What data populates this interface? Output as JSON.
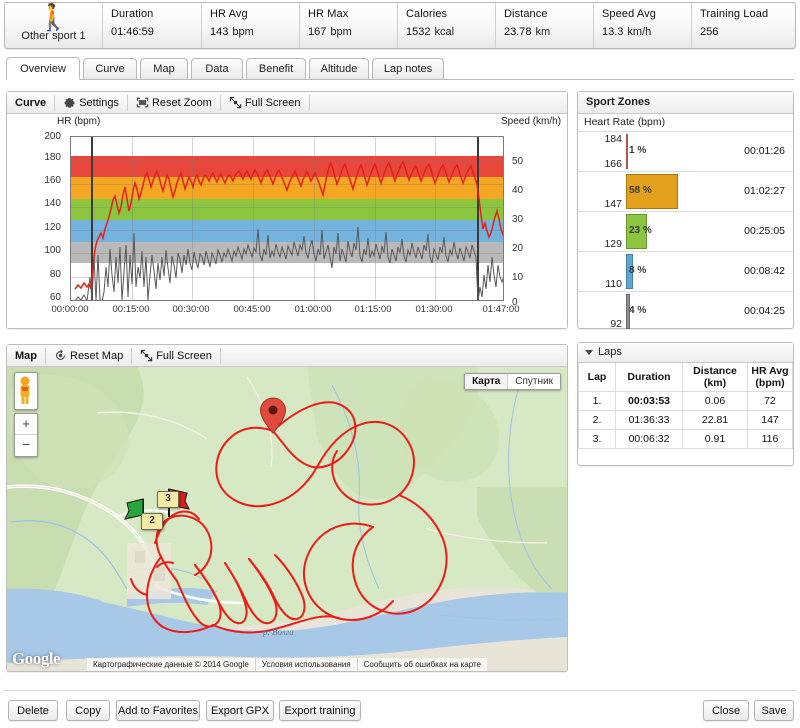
{
  "summary": {
    "sport": {
      "icon": "runner-icon",
      "name": "Other sport 1"
    },
    "cells": [
      {
        "label": "Duration",
        "value": "01:46:59",
        "unit": ""
      },
      {
        "label": "HR Avg",
        "value": "143",
        "unit": "bpm"
      },
      {
        "label": "HR Max",
        "value": "167",
        "unit": "bpm"
      },
      {
        "label": "Calories",
        "value": "1532",
        "unit": "kcal"
      },
      {
        "label": "Distance",
        "value": "23.78",
        "unit": "km"
      },
      {
        "label": "Speed Avg",
        "value": "13.3",
        "unit": "km/h"
      },
      {
        "label": "Training Load",
        "value": "256",
        "unit": ""
      }
    ]
  },
  "tabs": [
    {
      "label": "Overview",
      "active": true
    },
    {
      "label": "Curve",
      "active": false
    },
    {
      "label": "Map",
      "active": false
    },
    {
      "label": "Data",
      "active": false
    },
    {
      "label": "Benefit",
      "active": false
    },
    {
      "label": "Altitude",
      "active": false
    },
    {
      "label": "Lap notes",
      "active": false
    }
  ],
  "curve_panel": {
    "title": "Curve",
    "buttons": [
      {
        "label": "Settings",
        "icon": "gear-icon"
      },
      {
        "label": "Reset Zoom",
        "icon": "reset-zoom-icon"
      },
      {
        "label": "Full Screen",
        "icon": "full-screen-icon"
      }
    ]
  },
  "chart_data": {
    "type": "line",
    "title": "",
    "ylabel": "HR (bpm)",
    "y2label": "Speed (km/h)",
    "xlabel": "",
    "ylim": [
      60,
      200
    ],
    "y2lim": [
      0,
      56
    ],
    "yticks": [
      "200",
      "180",
      "160",
      "140",
      "120",
      "100",
      "80",
      "60"
    ],
    "y2ticks": [
      "50",
      "40",
      "30",
      "20",
      "10",
      "0"
    ],
    "xticks": [
      "00:00:00",
      "00:15:00",
      "00:30:00",
      "00:45:00",
      "01:00:00",
      "01:15:00",
      "01:30:00",
      "01:47:00"
    ],
    "grid": true,
    "legend": "none",
    "zone_bands": [
      {
        "name": "zone5",
        "from": 184,
        "to": 200,
        "color": "#ffffff"
      },
      {
        "name": "zone5",
        "from": 166,
        "to": 184,
        "color": "#e8483c"
      },
      {
        "name": "zone4",
        "from": 147,
        "to": 166,
        "color": "#f5a623"
      },
      {
        "name": "zone3",
        "from": 129,
        "to": 147,
        "color": "#8cc63e"
      },
      {
        "name": "zone2",
        "from": 110,
        "to": 129,
        "color": "#74b3dd"
      },
      {
        "name": "zone1",
        "from": 92,
        "to": 110,
        "color": "#b9b9b9"
      }
    ],
    "series": [
      {
        "name": "Heart rate",
        "color": "#e32119",
        "unit": "bpm",
        "avg": 143,
        "max": 167
      },
      {
        "name": "Speed",
        "color": "#585858",
        "unit": "km/h",
        "avg": 13.3
      }
    ],
    "markers": [
      {
        "name": "lap-marker-1",
        "x": "00:03:53"
      },
      {
        "name": "lap-marker-2",
        "x": "01:40:26"
      }
    ]
  },
  "zones_panel": {
    "title": "Sport Zones",
    "subtitle": "Heart Rate (bpm)",
    "rows": [
      {
        "hi": "184",
        "lo": "166",
        "percent": "1 %",
        "pct_num": 1,
        "time": "00:01:26",
        "color": "#f0736a"
      },
      {
        "hi": "",
        "lo": "147",
        "percent": "58 %",
        "pct_num": 58,
        "time": "01:02:27",
        "color": "#e2a01b"
      },
      {
        "hi": "",
        "lo": "129",
        "percent": "23 %",
        "pct_num": 23,
        "time": "00:25:05",
        "color": "#8cc63e"
      },
      {
        "hi": "",
        "lo": "110",
        "percent": "8 %",
        "pct_num": 8,
        "time": "00:08:42",
        "color": "#5ba8d6"
      },
      {
        "hi": "",
        "lo": "92",
        "percent": "4 %",
        "pct_num": 4,
        "time": "00:04:25",
        "color": "#8f8f8f"
      }
    ]
  },
  "laps_panel": {
    "title": "Laps",
    "columns": [
      {
        "label": "Lap",
        "sub": ""
      },
      {
        "label": "Duration",
        "sub": ""
      },
      {
        "label": "Distance",
        "sub": "(km)"
      },
      {
        "label": "HR Avg",
        "sub": "(bpm)"
      }
    ],
    "rows": [
      {
        "lap": "1.",
        "duration": "00:03:53",
        "distance": "0.06",
        "hr": "72",
        "bold": true
      },
      {
        "lap": "2.",
        "duration": "01:36:33",
        "distance": "22.81",
        "hr": "147",
        "bold": false
      },
      {
        "lap": "3.",
        "duration": "00:06:32",
        "distance": "0.91",
        "hr": "116",
        "bold": false
      }
    ]
  },
  "map_panel": {
    "title": "Map",
    "buttons": [
      {
        "label": "Reset Map",
        "icon": "reset-map-icon"
      },
      {
        "label": "Full Screen",
        "icon": "full-screen-icon"
      }
    ],
    "map_types": [
      {
        "label": "Карта",
        "selected": true
      },
      {
        "label": "Спутник",
        "selected": false
      }
    ],
    "zoom_in": "+",
    "zoom_out": "−",
    "logo": "Google",
    "attribution": [
      "Картографические данные © 2014 Google",
      "Условия использования",
      "Сообщить об ошибках на карте"
    ],
    "river_label": "р. Волга",
    "lap_flags": [
      "2",
      "3"
    ],
    "route_color": "#ee1c16"
  },
  "footer": {
    "left_buttons": [
      {
        "label": "Delete"
      },
      {
        "label": "Copy"
      },
      {
        "label": "Add to Favorites"
      },
      {
        "label": "Export GPX"
      },
      {
        "label": "Export training"
      }
    ],
    "right_buttons": [
      {
        "label": "Close"
      },
      {
        "label": "Save"
      }
    ]
  }
}
